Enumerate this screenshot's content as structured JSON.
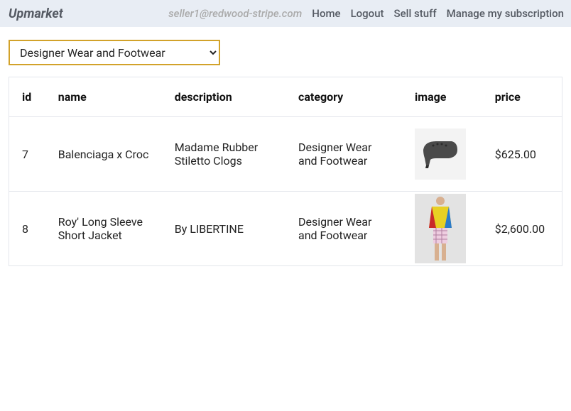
{
  "header": {
    "brand": "Upmarket",
    "user_email": "seller1@redwood-stripe.com",
    "nav": {
      "home": "Home",
      "logout": "Logout",
      "sell_stuff": "Sell stuff",
      "manage_sub": "Manage my subscription"
    }
  },
  "filter": {
    "selected": "Designer Wear and Footwear"
  },
  "table": {
    "columns": {
      "id": "id",
      "name": "name",
      "description": "description",
      "category": "category",
      "image": "image",
      "price": "price"
    },
    "rows": [
      {
        "id": "7",
        "name": "Balenciaga x Croc",
        "description": "Madame Rubber Stiletto Clogs",
        "category": "Designer Wear and Footwear",
        "image": "stiletto-clog-icon",
        "price": "$625.00"
      },
      {
        "id": "8",
        "name": "Roy' Long Sleeve Short Jacket",
        "description": "By LIBERTINE",
        "category": "Designer Wear and Footwear",
        "image": "colorful-jacket-icon",
        "price": "$2,600.00"
      }
    ]
  }
}
